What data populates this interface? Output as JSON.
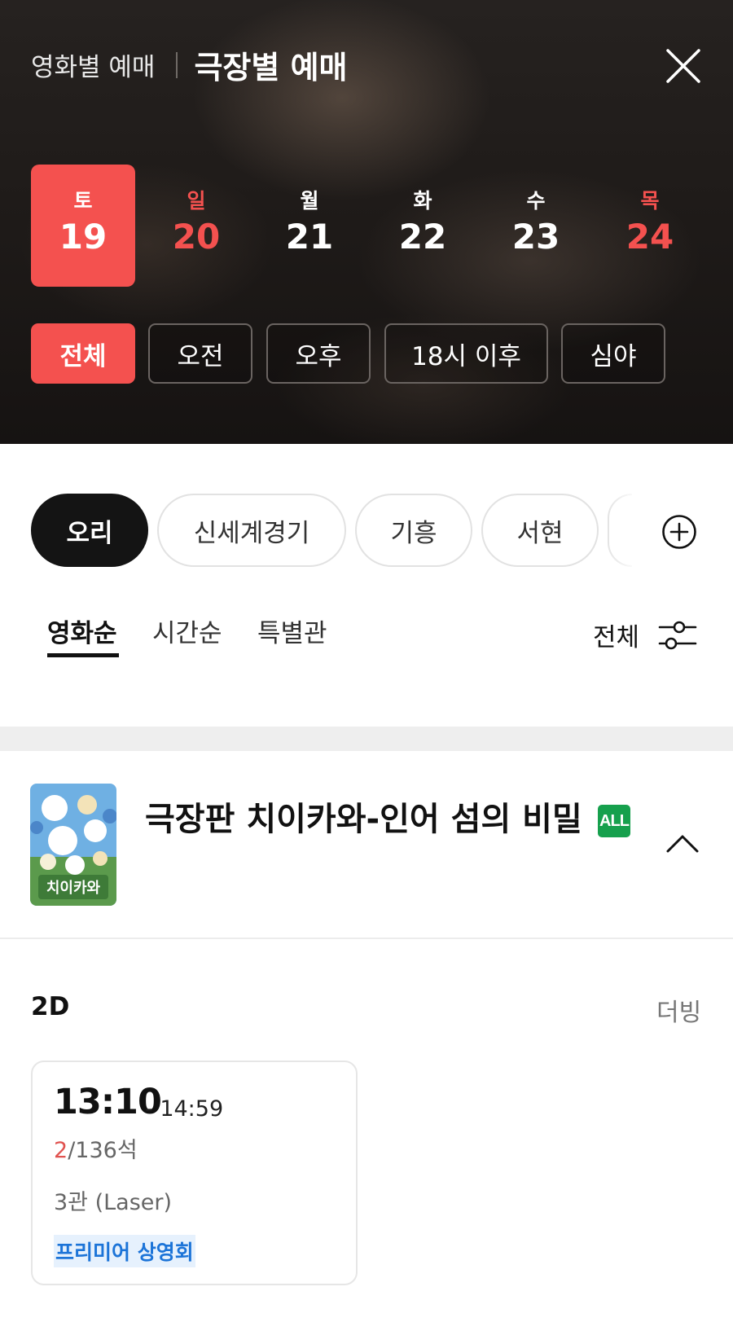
{
  "header": {
    "mode_inactive": "영화별 예매",
    "mode_active": "극장별 예매"
  },
  "dates": [
    {
      "dow": "토",
      "day": "19",
      "state": "selected"
    },
    {
      "dow": "일",
      "day": "20",
      "state": "holiday"
    },
    {
      "dow": "월",
      "day": "21",
      "state": "normal"
    },
    {
      "dow": "화",
      "day": "22",
      "state": "normal"
    },
    {
      "dow": "수",
      "day": "23",
      "state": "normal"
    },
    {
      "dow": "목",
      "day": "24",
      "state": "holiday"
    }
  ],
  "time_filters": [
    "전체",
    "오전",
    "오후",
    "18시 이후",
    "심야"
  ],
  "theaters": [
    "오리",
    "신세계경기",
    "기흥",
    "서현"
  ],
  "sort_tabs": [
    "영화순",
    "시간순",
    "특별관"
  ],
  "filter_label": "전체",
  "movie": {
    "title": "극장판 치이카와-인어 섬의 비밀",
    "rating": "ALL",
    "poster_text": "치이카와",
    "format": "2D",
    "language": "더빙",
    "showtimes": [
      {
        "start": "13:10",
        "end": "- 14:59",
        "seats_available": "2",
        "seats_total": "/136석",
        "hall": "3관 (Laser)",
        "tag": "프리미어 상영회"
      }
    ]
  },
  "colors": {
    "accent_red": "#f4514f",
    "rating_green": "#16a04d",
    "tag_blue": "#1c74d8",
    "dark": "#141414"
  }
}
